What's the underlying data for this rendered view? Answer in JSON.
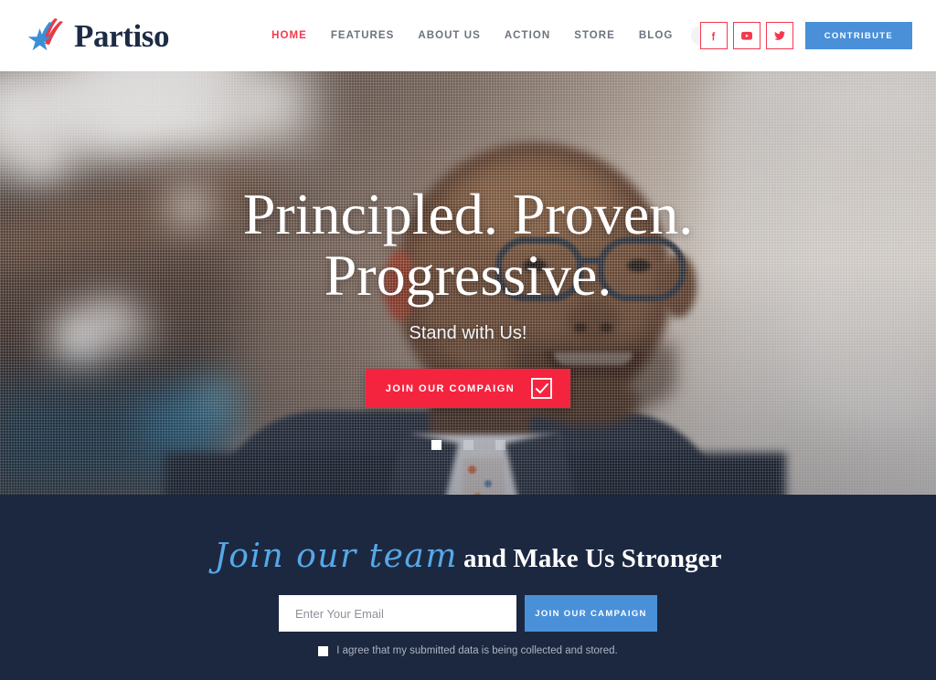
{
  "brand": {
    "name": "Partiso",
    "logo_icon": "star-swoosh-logo"
  },
  "nav": {
    "items": [
      {
        "label": "HOME",
        "active": true
      },
      {
        "label": "FEATURES",
        "active": false
      },
      {
        "label": "ABOUT US",
        "active": false
      },
      {
        "label": "ACTION",
        "active": false
      },
      {
        "label": "STORE",
        "active": false
      },
      {
        "label": "BLOG",
        "active": false
      }
    ],
    "more_icon": "kebab-menu-icon"
  },
  "header": {
    "social": [
      {
        "name": "facebook-icon",
        "label": "f"
      },
      {
        "name": "youtube-icon",
        "label": "YouTube"
      },
      {
        "name": "twitter-icon",
        "label": "Twitter"
      }
    ],
    "contribute_label": "CONTRIBUTE"
  },
  "hero": {
    "title_line1": "Principled. Proven.",
    "title_line2": "Progressive.",
    "subtitle": "Stand with Us!",
    "cta_label": "JOIN OUR COMPAIGN",
    "cta_icon": "checkbox-check-icon",
    "carousel": {
      "total": 3,
      "active_index": 0
    }
  },
  "newsletter": {
    "title_script": "Join our team",
    "title_bold": "and Make Us Stronger",
    "email_placeholder": "Enter Your Email",
    "email_value": "",
    "submit_label": "JOIN OUR CAMPAIGN",
    "consent_label": "I agree that my submitted data is being collected and stored.",
    "consent_checked": false
  },
  "colors": {
    "accent_red": "#f4394f",
    "cta_red": "#f4243f",
    "accent_blue": "#4a90d9",
    "script_blue": "#56a8e8",
    "navy": "#1c2840",
    "nav_gray": "#6c737e"
  }
}
